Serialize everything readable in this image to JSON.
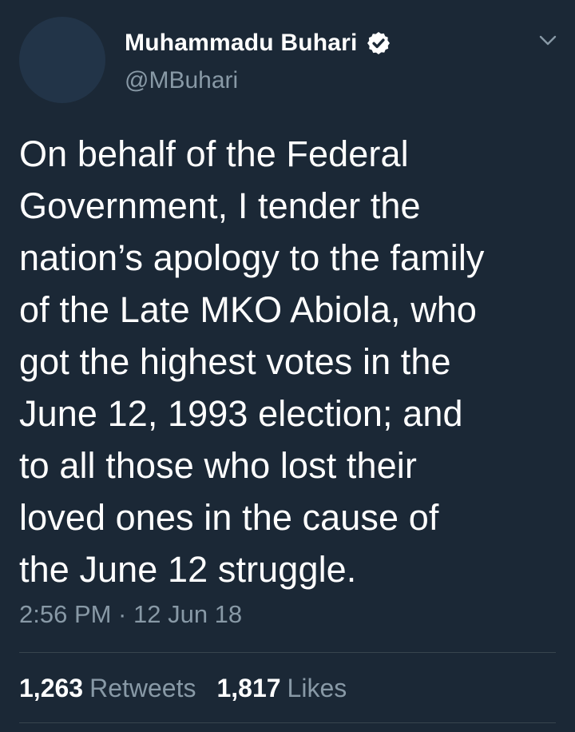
{
  "author": {
    "display_name": "Muhammadu Buhari",
    "handle": "@MBuhari",
    "verified_icon": "verified-badge-icon"
  },
  "menu_icon": "chevron-down-icon",
  "tweet": {
    "lines": [
      "On behalf of the Federal",
      "Government, I tender the",
      "nation’s apology to the family",
      "of the Late MKO Abiola, who",
      "got the highest votes in the",
      "June 12, 1993 election; and",
      "to all those who lost their",
      "loved ones in the cause of",
      "the June 12 struggle."
    ],
    "timestamp": "2:56 PM · 12 Jun 18"
  },
  "stats": {
    "retweets_count": "1,263",
    "retweets_label": "Retweets",
    "likes_count": "1,817",
    "likes_label": "Likes"
  },
  "colors": {
    "background": "#1b2836",
    "primary_text": "#ffffff",
    "secondary_text": "#8899a6",
    "divider": "#38444d",
    "avatar_placeholder": "#223448"
  }
}
